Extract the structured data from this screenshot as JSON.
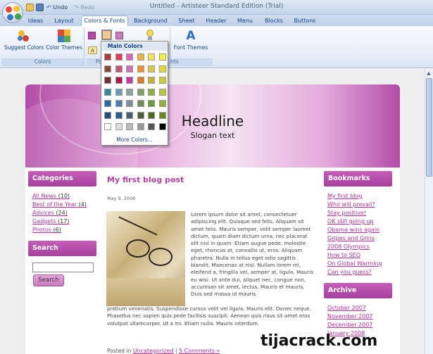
{
  "window": {
    "title": "Untitled - Artisteer Standard Edition (Trial)",
    "undo_label": "Undo",
    "redo_label": "Redo"
  },
  "tabs": [
    "Ideas",
    "Layout",
    "Colors & Fonts",
    "Background",
    "Sheet",
    "Header",
    "Menu",
    "Blocks",
    "Buttons"
  ],
  "active_tab": "Colors & Fonts",
  "ribbon": {
    "suggest_colors_label": "Suggest Colors",
    "color_themes_label": "Color Themes",
    "font_themes_label": "Font Themes",
    "group_colors_label": "Colors",
    "group_palette_label_partial": "Pa",
    "group_fonts_label_partial": "nts",
    "mini_button_label": "A"
  },
  "color_popup": {
    "header": "Main Colors",
    "more_colors_label": "More Colors...",
    "swatches": [
      [
        "#a83d3d",
        "#e23b5a",
        "#d966b9",
        "#ecb33c",
        "#f2e25c",
        "#f7f23c"
      ],
      [
        "#8a4a33",
        "#c7527a",
        "#cf74b3",
        "#ef8e36",
        "#dcc845",
        "#e2d83a"
      ],
      [
        "#7a2d2d",
        "#a91d4a",
        "#c63ba0",
        "#e07a26",
        "#c4b436",
        "#cccc33"
      ],
      [
        "#2c8a9a",
        "#6b9bb0",
        "#8aa2a0",
        "#7fa066",
        "#8fb041",
        "#b7c83c"
      ],
      [
        "#2a6aa6",
        "#4b7fb6",
        "#7b8fa0",
        "#6f8c5a",
        "#6f9a3a",
        "#8fb030"
      ],
      [
        "#234d7a",
        "#2f5a92",
        "#4b5e6e",
        "#4c5f3c",
        "#4b6a2a",
        "#6b8a22"
      ],
      [
        "#ffffff",
        "#dddddd",
        "#bbbbbb",
        "#999999",
        "#555555",
        "#000000"
      ]
    ]
  },
  "site": {
    "headline": "Headline",
    "slogan": "Slogan text",
    "categories_title": "Categories",
    "categories": [
      {
        "label": "All News",
        "count": "(10)"
      },
      {
        "label": "Best of the Year",
        "count": "(4)"
      },
      {
        "label": "Advices",
        "count": "(24)"
      },
      {
        "label": "Gadgets",
        "count": "(17)"
      },
      {
        "label": "Photos",
        "count": "(6)"
      }
    ],
    "search_title": "Search",
    "search_button": "Search",
    "search_value": "",
    "post": {
      "title": "My first blog post",
      "date": "May 9, 2008",
      "text_right": "Lorem ipsum dolor sit amet, consectetuer adipiscing elit. Quisque sed felis. Aliquam sit amet felis. Mauris semper, velit semper laoreet dictum, quam diam dictum urna, nec placerat elit nisl in quam. Etiam augue pede, molestie eget, rhoncus at, convallis ut, eros. Aliquam pharetra. Nulla in tellus eget odio sagittis blandit. Maecenas at nisl. Nullam lorem mi, eleifend a, fringilla vel, semper at, ligula. Mauris eu wisi. Ut ante dui, aliquet nec, congue non, accumsan sit amet, lectus. Mauris et mauris. Duis sed massa id mauris",
      "text_bottom": "pretium venenatis. Suspendisse cursus velit vel ligula. Mauris elit. Donec neque. Phasellus nec sapien quis pede facilisis suscipit. Aenean quis risus sit amet eros volutpat ullamcorper. Ut a mi. Etiam nulla. Mauris interdum.",
      "footer_posted": "Posted in",
      "footer_category": "Uncategorized",
      "footer_sep": "|",
      "footer_comments": "5 Comments »"
    },
    "bookmarks_title": "Bookmarks",
    "bookmarks": [
      "My first blog",
      "Who will prevail?",
      "Stay positive!",
      "OK still going up",
      "Obama wins again",
      "Gripes and Grins",
      "2008 Olympics",
      "How to SEO",
      "On Global Warming",
      "Can you guess?"
    ],
    "archive_title": "Archive",
    "archive": [
      "October 2007",
      "November 2007",
      "December 2007",
      "January 2008"
    ]
  },
  "watermark": "tijacrack.com"
}
